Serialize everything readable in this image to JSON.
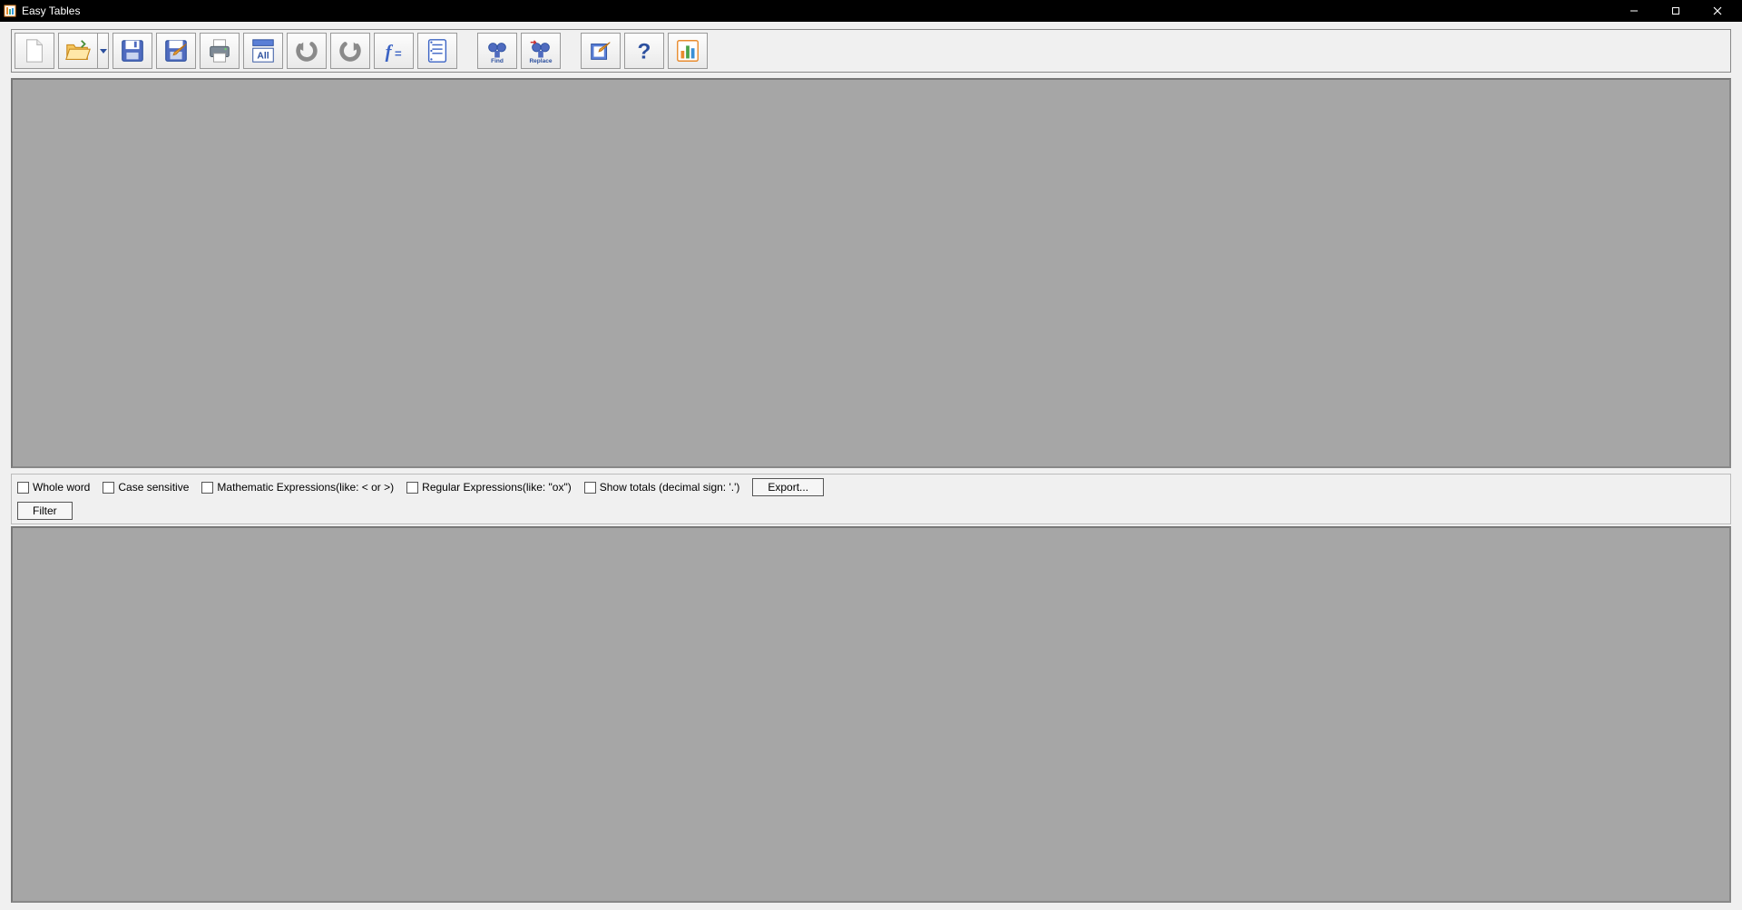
{
  "window": {
    "title": "Easy Tables"
  },
  "options": {
    "whole_word": "Whole word",
    "case_sensitive": "Case sensitive",
    "math_expr": "Mathematic Expressions(like: < or >)",
    "regex": "Regular Expressions(like: \"ox\")",
    "show_totals": "Show totals (decimal sign: '.')",
    "export": "Export...",
    "filter": "Filter"
  },
  "toolbar": {
    "new": "New",
    "open": "Open",
    "save": "Save",
    "save_edit": "Save Edit",
    "print": "Print",
    "select_all": "Select All",
    "undo": "Undo",
    "redo": "Redo",
    "formula": "Formula",
    "notes": "Notes",
    "find": "Find",
    "replace": "Replace",
    "options": "Options",
    "help": "Help",
    "chart": "Chart"
  }
}
